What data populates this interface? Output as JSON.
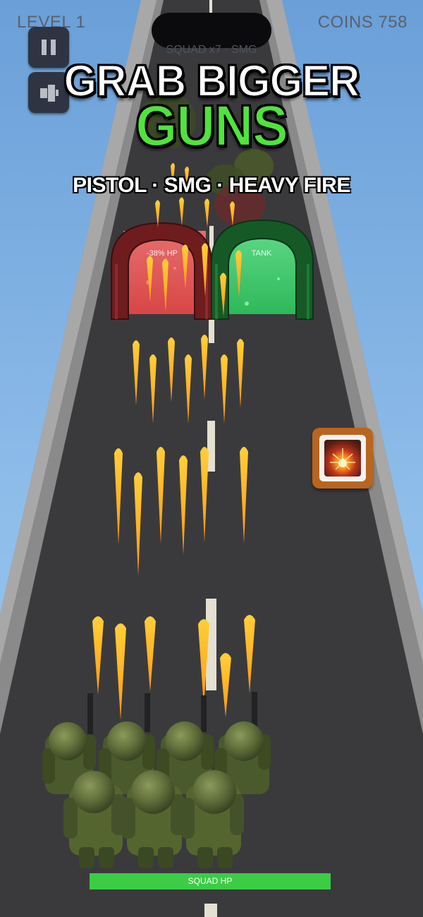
{
  "hud": {
    "level_label": "LEVEL 1",
    "coins_label": "COINS 758",
    "squad_info": "SQUAD x7 · SMG",
    "pause_icon": "pause-icon",
    "camera_icon": "camera-view-icon"
  },
  "headline": {
    "line1": "GRAB BIGGER",
    "line2": "GUNS",
    "subtitle": "PISTOL · SMG · HEAVY FIRE",
    "line1_color": "#ffffff",
    "line2_color": "#4fe43c"
  },
  "gates": [
    {
      "label": "-38% HP",
      "color": "#d84646",
      "type": "negative"
    },
    {
      "label": "TANK",
      "color": "#34b860",
      "type": "positive"
    }
  ],
  "powerup": {
    "icon": "explosion-icon",
    "frame_color": "#b9651f"
  },
  "squad": {
    "soldier_count": 7,
    "weapon": "SMG"
  },
  "squad_hp": {
    "label": "SQUAD HP",
    "fraction": 1.0,
    "color": "#3ccc46"
  }
}
